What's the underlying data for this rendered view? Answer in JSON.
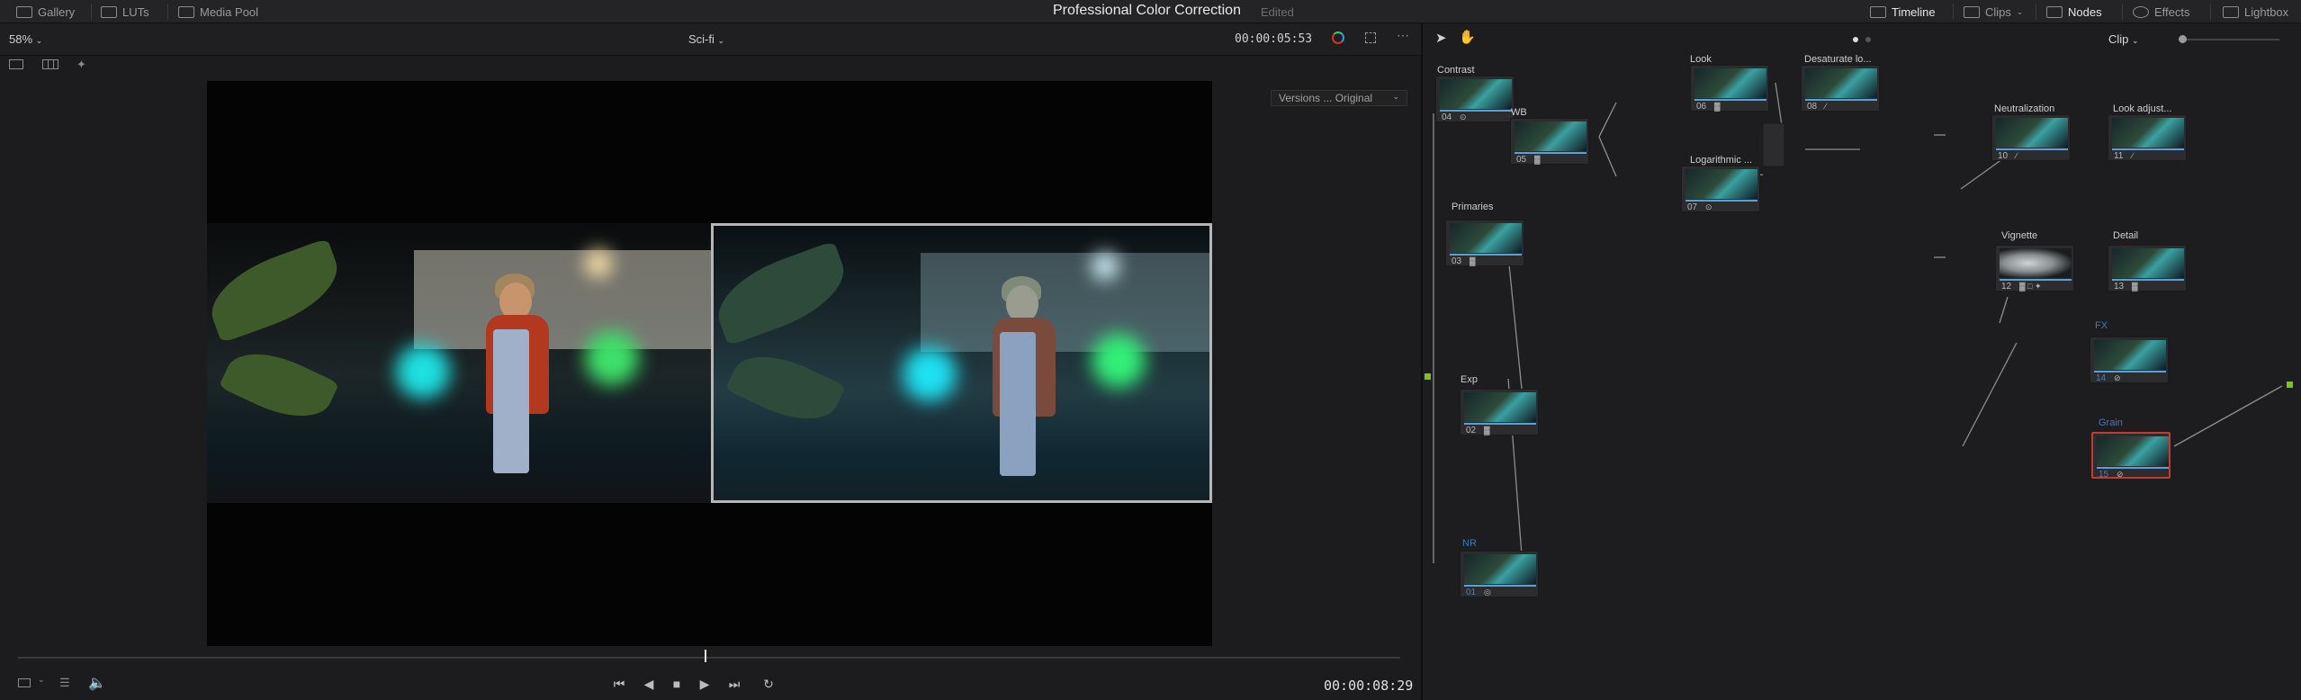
{
  "topbar": {
    "gallery": "Gallery",
    "luts": "LUTs",
    "media_pool": "Media Pool",
    "project_title": "Professional Color Correction",
    "status": "Edited",
    "timeline": "Timeline",
    "clips": "Clips",
    "nodes": "Nodes",
    "effects": "Effects",
    "lightbox": "Lightbox"
  },
  "viewer": {
    "zoom": "58%",
    "clip_name": "Sci-fi",
    "timecode_top": "00:00:05:53",
    "versions": "Versions ... Original",
    "timecode_bottom": "00:00:08:29",
    "playhead_fraction": 0.497
  },
  "nodes_panel": {
    "mode": "Clip",
    "nodes": [
      {
        "label": "Contrast",
        "num": "04",
        "badge": "⊙"
      },
      {
        "label": "WB",
        "num": "05",
        "badge": "▓"
      },
      {
        "label": "Look",
        "num": "06",
        "badge": "▓"
      },
      {
        "label": "Desaturate lo...",
        "num": "08",
        "badge": "∕"
      },
      {
        "label": "Logarithmic ...",
        "num": "07",
        "badge": "⊙"
      },
      {
        "label": "Neutralization",
        "num": "10",
        "badge": "∕"
      },
      {
        "label": "Look adjust...",
        "num": "11",
        "badge": "∕"
      },
      {
        "label": "Primaries",
        "num": "03",
        "badge": "▓"
      },
      {
        "label": "Vignette",
        "num": "12",
        "badge": "▓ □ ✦"
      },
      {
        "label": "Detail",
        "num": "13",
        "badge": "▓"
      },
      {
        "label": "FX",
        "num": "14",
        "badge": "⊘"
      },
      {
        "label": "Exp",
        "num": "02",
        "badge": "▓"
      },
      {
        "label": "Grain",
        "num": "15",
        "badge": "⊘"
      },
      {
        "label": "NR",
        "num": "01",
        "badge": "◎"
      }
    ]
  },
  "icons": {
    "gallery": "gallery-icon",
    "luts": "luts-icon",
    "media_pool": "media-pool-icon",
    "timeline": "timeline-icon",
    "clips": "clips-icon",
    "nodes": "nodes-icon",
    "effects": "effects-icon",
    "lightbox": "lightbox-icon"
  },
  "colors": {
    "accent_blue": "#38a8e8",
    "input_green": "#7fbf1e",
    "selected_node": "#c43a2f",
    "disabled_label": "#3f78c0"
  }
}
